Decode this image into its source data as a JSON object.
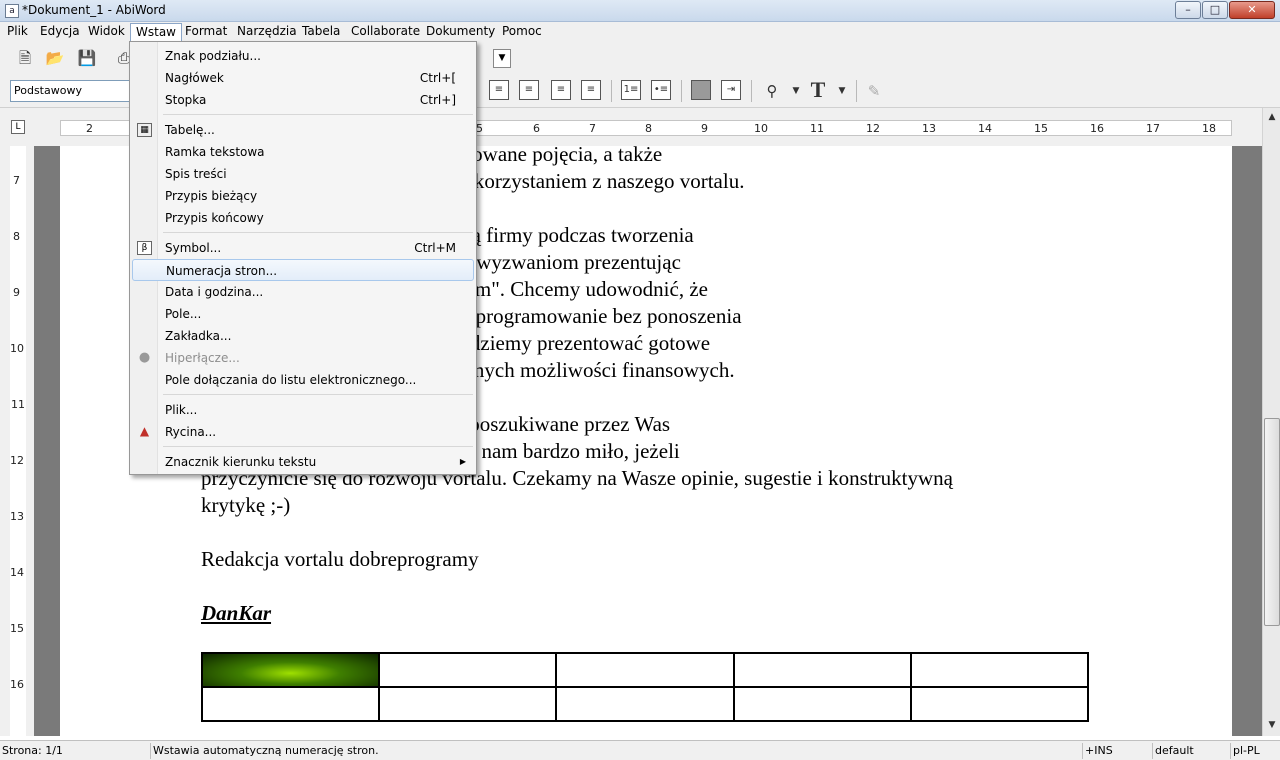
{
  "window": {
    "title": "*Dokument_1 - AbiWord",
    "app_icon": "abiword-icon"
  },
  "menubar": [
    "Plik",
    "Edycja",
    "Widok",
    "Wstaw",
    "Format",
    "Narzędzia",
    "Tabela",
    "Collaborate",
    "Dokumenty",
    "Pomoc"
  ],
  "active_menu": "Wstaw",
  "toolbar": {
    "style_value": "Podstawowy"
  },
  "ruler": {
    "numbers": [
      "2",
      "5",
      "6",
      "7",
      "8",
      "9",
      "10",
      "11",
      "12",
      "13",
      "14",
      "15",
      "16",
      "17",
      "18"
    ]
  },
  "vruler": {
    "numbers": [
      "7",
      "8",
      "9",
      "10",
      "11",
      "12",
      "13",
      "14",
      "15",
      "16"
    ]
  },
  "insert_menu": [
    {
      "label": "Znak podziału...",
      "accel": ""
    },
    {
      "label": "Nagłówek",
      "accel": "Ctrl+["
    },
    {
      "label": "Stopka",
      "accel": "Ctrl+]"
    },
    {
      "label": "Tabelę...",
      "accel": "",
      "icon": "table-icon"
    },
    {
      "label": "Ramka tekstowa",
      "accel": ""
    },
    {
      "label": "Spis treści",
      "accel": ""
    },
    {
      "label": "Przypis bieżący",
      "accel": ""
    },
    {
      "label": "Przypis końcowy",
      "accel": ""
    },
    {
      "label": "Symbol...",
      "accel": "Ctrl+M",
      "icon": "symbol-icon"
    },
    {
      "label": "Numeracja stron...",
      "accel": "",
      "highlighted": true
    },
    {
      "label": "Data i godzina...",
      "accel": ""
    },
    {
      "label": "Pole...",
      "accel": ""
    },
    {
      "label": "Zakładka...",
      "accel": ""
    },
    {
      "label": "Hiperłącze...",
      "accel": "",
      "disabled": true,
      "icon": "hyperlink-icon"
    },
    {
      "label": "Pole dołączania do listu elektronicznego...",
      "accel": ""
    },
    {
      "label": "Plik...",
      "accel": ""
    },
    {
      "label": "Rycina...",
      "accel": "",
      "icon": "picture-icon"
    },
    {
      "label": "Znacznik kierunku tekstu",
      "accel": "",
      "submenu": true
    }
  ],
  "document": {
    "lines": [
      "ramowania, wyjaśniać skomplikowane pojęcia, a także",
      "związane z oprogramowaniem i korzystaniem z naszego vortalu.",
      "lne problemy na jakie napotykają firmy podczas tworzenia",
      "aramy się wyjść na przeciw tym wyzwaniom prezentując",
      "e a także porady w cyklu \"dla firm\". Chcemy udowodnić, że",
      "ezbędne, nowoczesne i legalne oprogramowanie bez ponoszenia",
      "ch. W cyklu porad \"dla firm\" będziemy prezentować gotowe",
      "różne potrzeby w kontekście różnych możliwości finansowych.",
      "n vortalu znajdziecie wszystkie poszukiwane przez Was",
      "jemnością go odwiedzać. Będzie nam bardzo miło, jeżeli",
      "przyczynicie się do rozwoju vortalu. Czekamy na Wasze opinie, sugestie i konstruktywną",
      "krytykę ;-)",
      "Redakcja vortalu dobreprogramy"
    ],
    "signature": "DanKar"
  },
  "statusbar": {
    "page": "Strona: 1/1",
    "message": "Wstawia automatyczną numerację stron.",
    "mode": "+INS",
    "style": "default",
    "lang": "pl-PL"
  },
  "colors": {
    "menu_highlight": "#e3edf9",
    "document_background": "#7a7a7a",
    "title_bar": "#c9d9ec"
  }
}
